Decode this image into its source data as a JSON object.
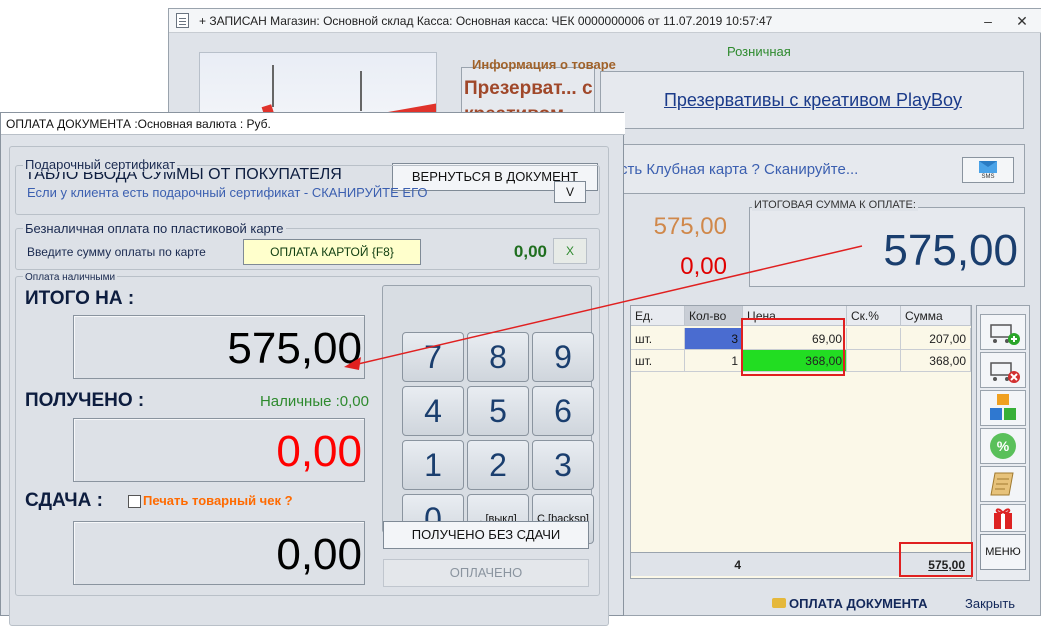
{
  "main_window": {
    "title": "+ ЗАПИСАН Магазин: Основной склад Касса: Основная касса: ЧЕК 0000000006 от 11.07.2019 10:57:47",
    "product_info_legend": "Информация о товаре",
    "price_type": "Розничная",
    "product_short": "Презерват... с креативом",
    "product_name": "Презервативы с креативом PlayBoy",
    "club_card_prompt": "сть Клубная карта ? Сканируйте...",
    "sms_label": "SMS",
    "mid_sum_a": "575,00",
    "mid_sum_b": "0,00",
    "total_legend": "ИТОГОВАЯ СУММА К ОПЛАТЕ:",
    "total_value": "575,00",
    "table": {
      "headers": [
        "Ед.",
        "Кол-во",
        "Цена",
        "Ск.%",
        "Сумма"
      ],
      "rows": [
        {
          "unit": "шт.",
          "qty": "3",
          "price": "69,00",
          "discount": "",
          "sum": "207,00"
        },
        {
          "unit": "шт.",
          "qty": "1",
          "price": "368,00",
          "discount": "",
          "sum": "368,00"
        }
      ],
      "footer_qty": "4",
      "footer_sum": "575,00"
    },
    "menu_label": "МЕНЮ",
    "payment_link": "ОПЛАТА ДОКУМЕНТА",
    "close_link": "Закрыть",
    "colors": {
      "qty_highlight": "#4a6cd0",
      "price_highlight": "#22dd22",
      "annotation": "#e02020"
    }
  },
  "pay_dialog": {
    "title": "ОПЛАТА ДОКУМЕНТА :Основная валюта : Руб.",
    "board_title": "ТАБЛО ВВОДА СУММЫ ОТ ПОКУПАТЕЛЯ",
    "return_button": "ВЕРНУТЬСЯ В ДОКУМЕНТ",
    "gift_legend": "Подарочный сертификат",
    "gift_hint": "Если у клиента есть подарочный сертификат - СКАНИРУЙТЕ ЕГО",
    "gift_button": "V",
    "card_legend": "Безналичная оплата по пластиковой карте",
    "card_hint": "Введите сумму оплаты по карте",
    "card_pay_button": "ОПЛАТА КАРТОЙ  {F8}",
    "card_amount": "0,00",
    "card_clear_button": "X",
    "cash_legend": "Оплата наличными",
    "total_on_label": "ИТОГО НА :",
    "total_on_value": "575,00",
    "received_label": "ПОЛУЧЕНО :",
    "cash_received": "Наличные :0,00",
    "received_value": "0,00",
    "change_label": "СДАЧА :",
    "print_check_label": "Печать товарный чек ?",
    "change_value": "0,00",
    "keypad": [
      "7",
      "8",
      "9",
      "4",
      "5",
      "6",
      "1",
      "2",
      "3",
      "0",
      ". [выкл]",
      "С [backsp]"
    ],
    "no_change_button": "ПОЛУЧЕНО БЕЗ СДАЧИ",
    "paid_button": "ОПЛАЧЕНО"
  }
}
